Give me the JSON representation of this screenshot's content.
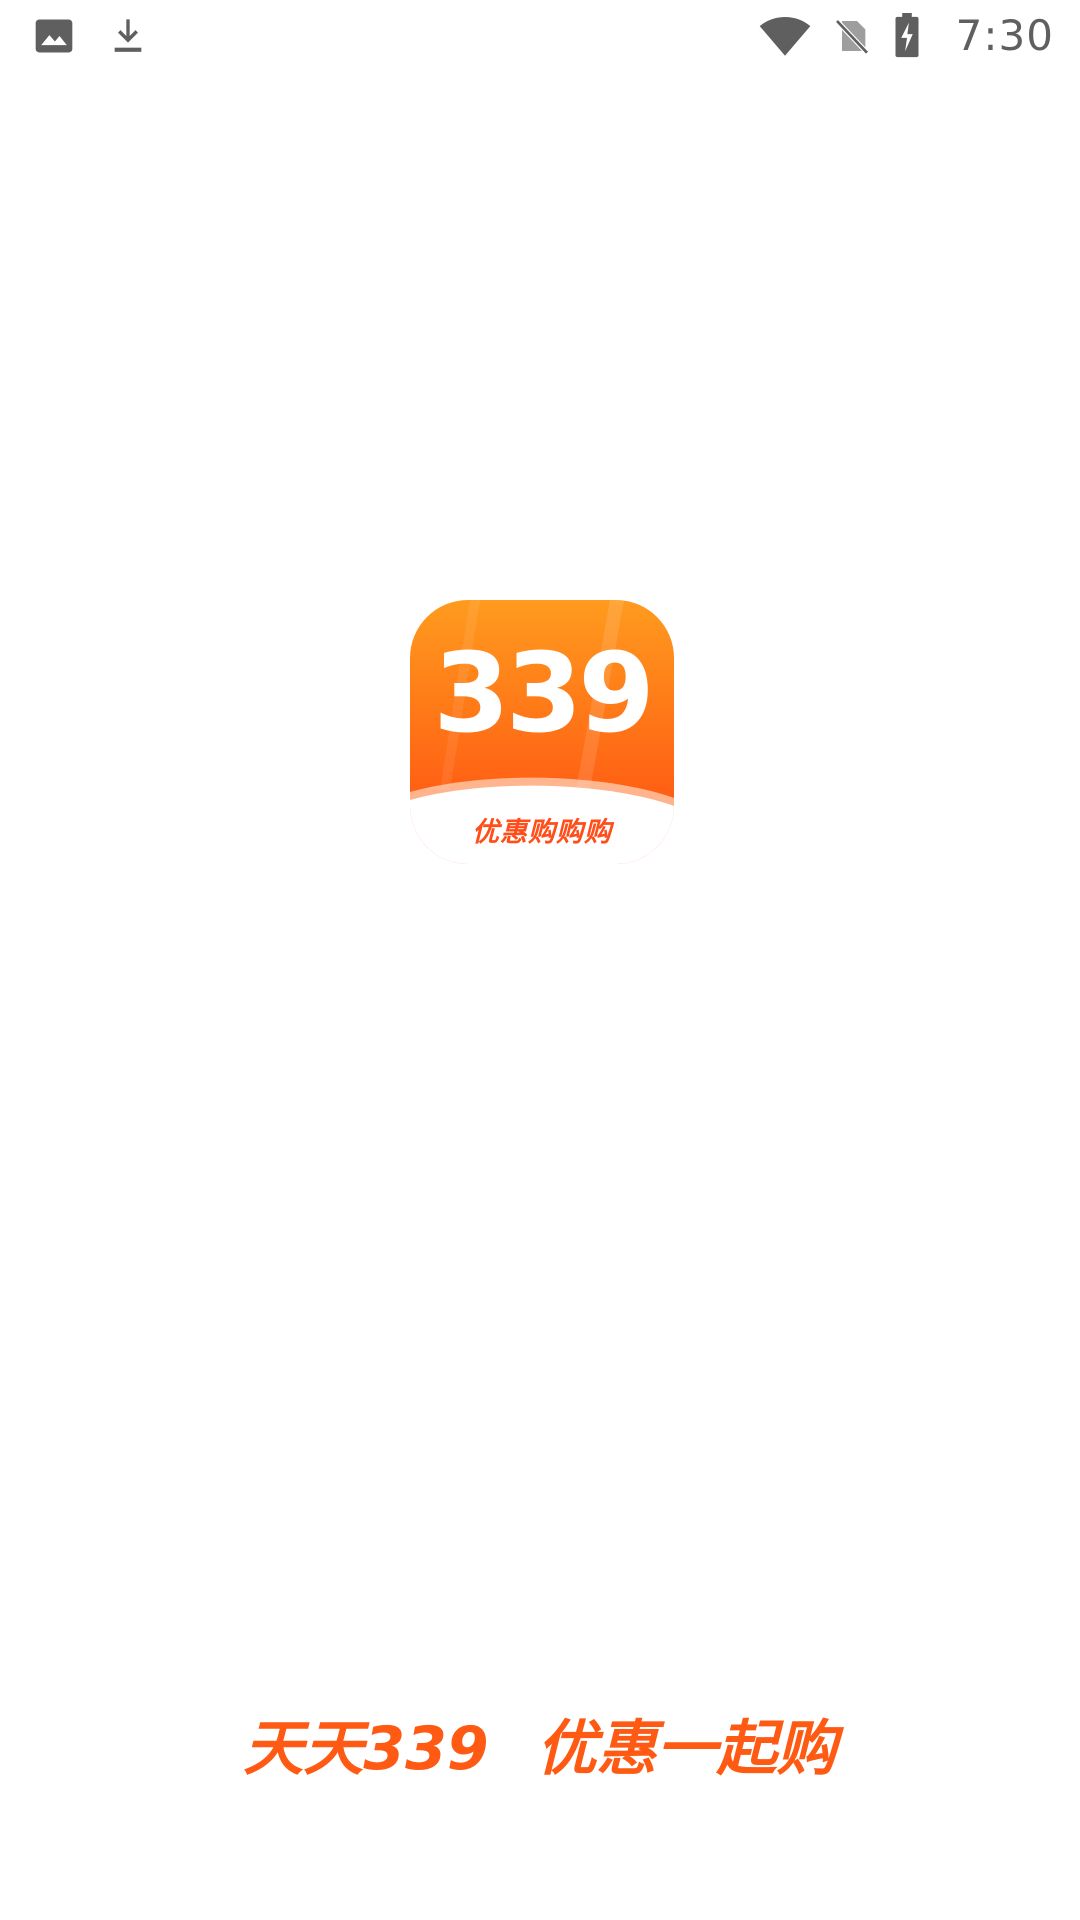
{
  "status_bar": {
    "time": "7:30",
    "left_icons": [
      "image-icon",
      "download-icon"
    ],
    "right_icons": [
      "wifi-icon",
      "no-sim-icon",
      "battery-charging-icon"
    ]
  },
  "splash": {
    "logo": {
      "number": "339",
      "subtitle": "优惠购购购",
      "colors": {
        "gradient_top": "#ff9b1e",
        "gradient_bottom": "#ff4a10",
        "text": "#ffffff",
        "subtitle": "#ff4e1a"
      }
    },
    "slogan_part1": "天天339",
    "slogan_part2": "优惠一起购",
    "slogan_color": "#ff5a14"
  }
}
